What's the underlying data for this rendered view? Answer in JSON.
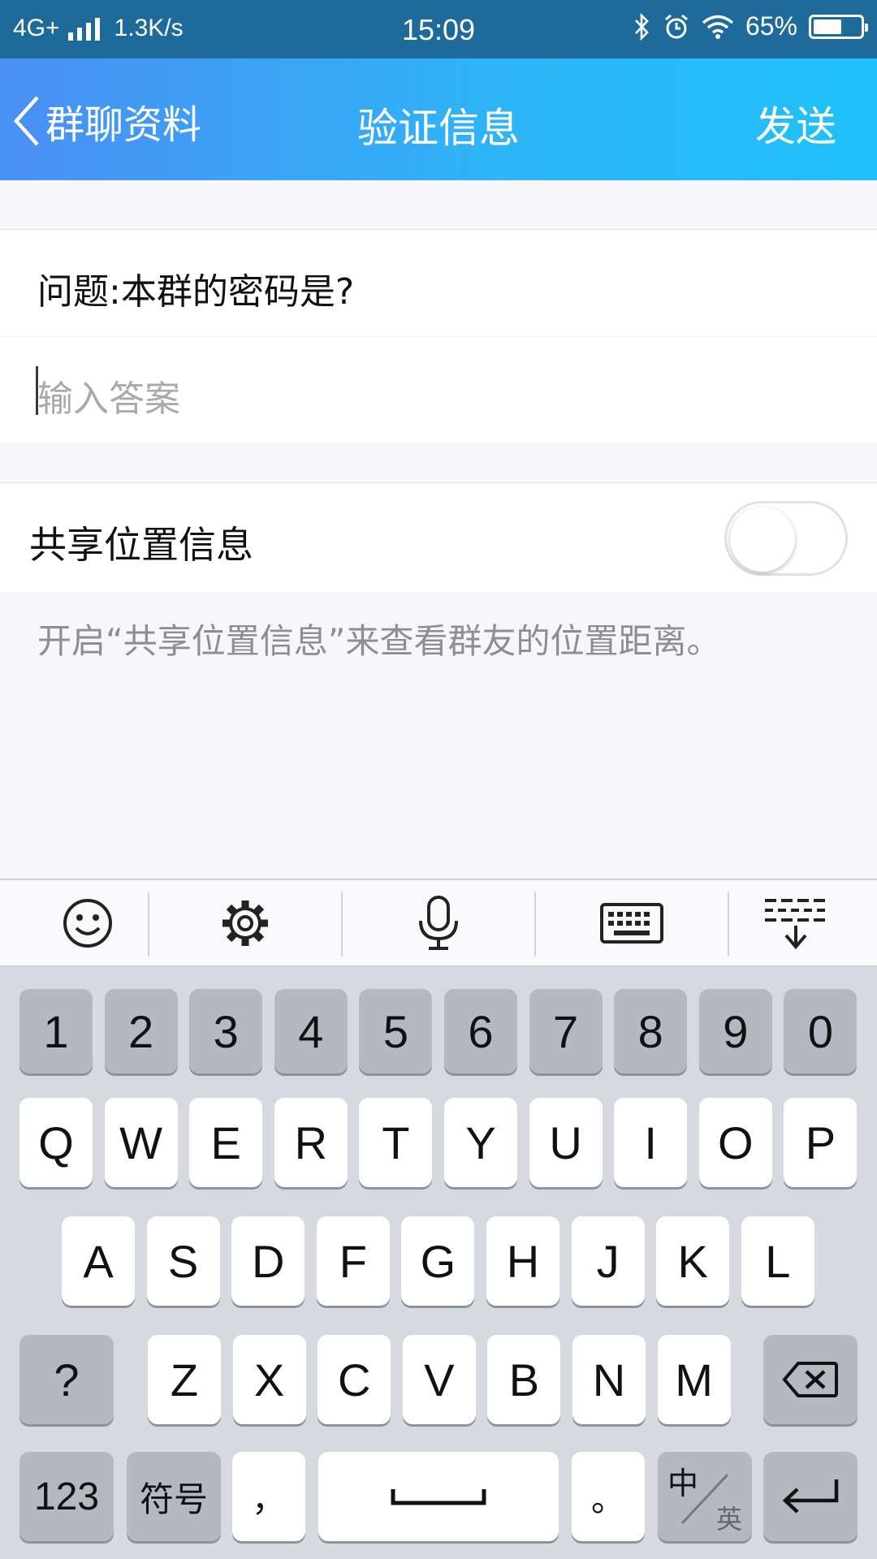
{
  "status_bar": {
    "network": "4G+",
    "speed": "1.3K/s",
    "time": "15:09",
    "battery": "65%",
    "battery_level": 0.65
  },
  "nav": {
    "back_label": "群聊资料",
    "title": "验证信息",
    "send_label": "发送"
  },
  "form": {
    "question": "问题:本群的密码是?",
    "answer_value": "",
    "answer_placeholder": "输入答案",
    "share_location_label": "共享位置信息",
    "share_location_on": false,
    "hint": "开启“共享位置信息”来查看群友的位置距离。"
  },
  "keyboard": {
    "toolbar": [
      "emoji-icon",
      "gear-icon",
      "microphone-icon",
      "keyboard-icon",
      "keyboard-hide-icon"
    ],
    "numbers": [
      "1",
      "2",
      "3",
      "4",
      "5",
      "6",
      "7",
      "8",
      "9",
      "0"
    ],
    "row1": [
      "Q",
      "W",
      "E",
      "R",
      "T",
      "Y",
      "U",
      "I",
      "O",
      "P"
    ],
    "row2": [
      "A",
      "S",
      "D",
      "F",
      "G",
      "H",
      "J",
      "K",
      "L"
    ],
    "row3": [
      "Z",
      "X",
      "C",
      "V",
      "B",
      "N",
      "M"
    ],
    "question_key": "?",
    "key_123": "123",
    "symbols_key": "符号",
    "comma_key": "，",
    "period_key": "。",
    "lang_top": "中",
    "lang_bottom": "英"
  },
  "colors": {
    "nav_gradient_start": "#4a8ff3",
    "nav_gradient_end": "#1fc1fb",
    "status_bar": "#1e6a9a",
    "placeholder": "#a8a8ad"
  }
}
